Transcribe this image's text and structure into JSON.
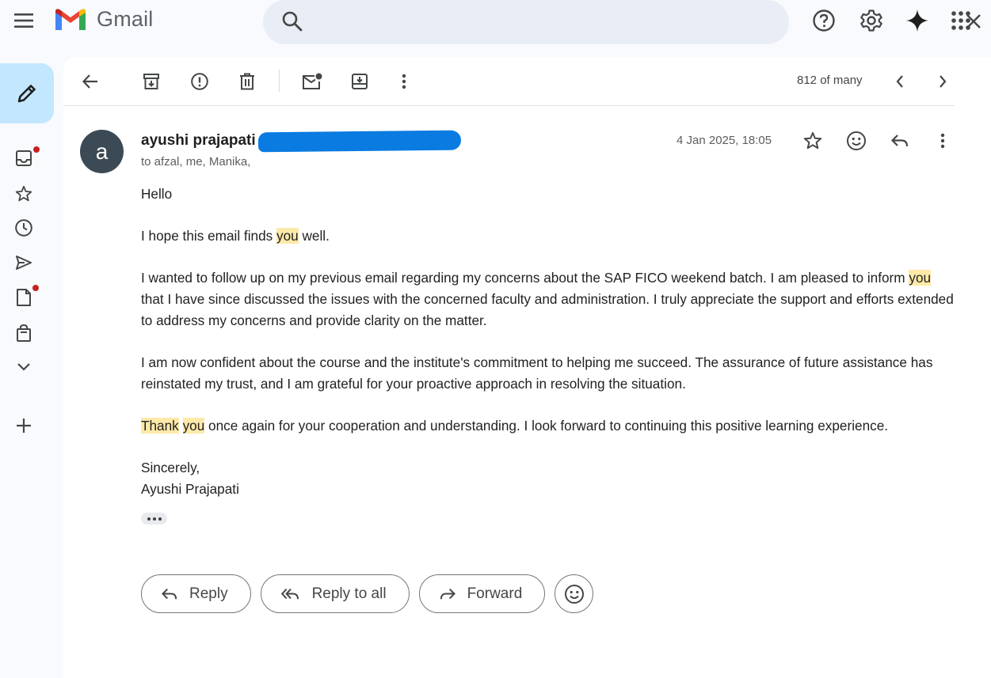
{
  "app": {
    "name": "Gmail"
  },
  "colors": {
    "accent": "#0b57d0",
    "compose_bg": "#c2e7ff",
    "highlight": "#fde9a8",
    "notification_dot": "#c5221f",
    "avatar_bg": "#3c4a55"
  },
  "search": {
    "value": "",
    "placeholder": ""
  },
  "toolbar": {
    "pager": "812 of many"
  },
  "message": {
    "avatar_letter": "a",
    "sender": "ayushi prajapati",
    "recipients": "to afzal, me, Manika,",
    "date": "4 Jan 2025, 18:05",
    "greeting": "Hello",
    "p1_a": "I hope this email finds ",
    "p1_hl": "you",
    "p1_b": " well.",
    "p2_a": "I wanted to follow up on my previous email regarding my concerns about the SAP FICO weekend batch. I am pleased to inform ",
    "p2_hl": "you",
    "p2_b": " that I have since discussed the issues with the concerned faculty and administration. I truly appreciate the support and efforts extended to address my concerns and provide clarity on the matter.",
    "p3": "I am now confident about the course and the institute's commitment to helping me succeed. The assurance of future assistance has reinstated my trust, and I am grateful for your proactive approach in resolving the situation.",
    "p4_hl1": "Thank",
    "p4_sp": " ",
    "p4_hl2": "you",
    "p4_b": " once again for your cooperation and understanding. I look forward to continuing this positive learning experience.",
    "sign_off": "Sincerely,",
    "signature": "Ayushi Prajapati"
  },
  "actions": {
    "reply": "Reply",
    "reply_all": "Reply to all",
    "forward": "Forward"
  },
  "icons": [
    "menu-icon",
    "gmail-logo-icon",
    "search-icon",
    "close-icon",
    "tune-icon",
    "help-icon",
    "gear-icon",
    "gemini-sparkle-icon",
    "apps-grid-icon",
    "pencil-icon",
    "inbox-icon",
    "star-icon",
    "clock-icon",
    "send-icon",
    "draft-icon",
    "bag-icon",
    "chevron-down-icon",
    "plus-icon",
    "back-arrow-icon",
    "archive-icon",
    "report-icon",
    "trash-icon",
    "mark-unread-icon",
    "move-to-icon",
    "more-vert-icon",
    "chevron-left-icon",
    "chevron-right-icon",
    "emoji-icon",
    "reply-icon",
    "reply-all-icon",
    "forward-icon"
  ]
}
